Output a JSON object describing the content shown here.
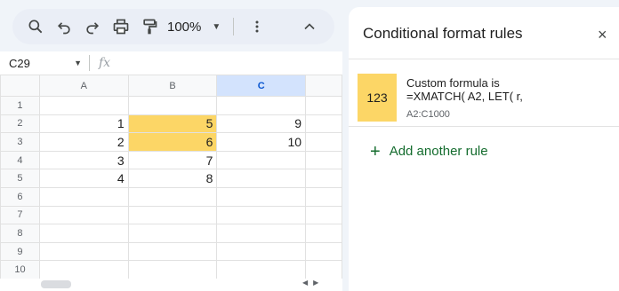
{
  "toolbar": {
    "zoom": "100%"
  },
  "formula_bar": {
    "name_box": "C29",
    "fx_label": "fx",
    "formula": ""
  },
  "sheet": {
    "columns": [
      "A",
      "B",
      "C"
    ],
    "selected_column": "C",
    "rows": [
      {
        "num": "1",
        "a": "",
        "b": "",
        "c": ""
      },
      {
        "num": "2",
        "a": "1",
        "b": "5",
        "c": "9"
      },
      {
        "num": "3",
        "a": "2",
        "b": "6",
        "c": "10"
      },
      {
        "num": "4",
        "a": "3",
        "b": "7",
        "c": ""
      },
      {
        "num": "5",
        "a": "4",
        "b": "8",
        "c": ""
      },
      {
        "num": "6",
        "a": "",
        "b": "",
        "c": ""
      },
      {
        "num": "7",
        "a": "",
        "b": "",
        "c": ""
      },
      {
        "num": "8",
        "a": "",
        "b": "",
        "c": ""
      },
      {
        "num": "9",
        "a": "",
        "b": "",
        "c": ""
      },
      {
        "num": "10",
        "a": "",
        "b": "",
        "c": ""
      }
    ],
    "highlight_color": "#fcd666"
  },
  "panel": {
    "title": "Conditional format rules",
    "close_label": "×",
    "rule": {
      "preview": "123",
      "line1": "Custom formula is",
      "line2": "=XMATCH( A2, LET( r,",
      "range": "A2:C1000"
    },
    "add_rule_label": "Add another rule",
    "add_rule_plus": "+"
  },
  "colors": {
    "accent_green": "#146c2e",
    "selected_header": "#d3e3fd"
  }
}
